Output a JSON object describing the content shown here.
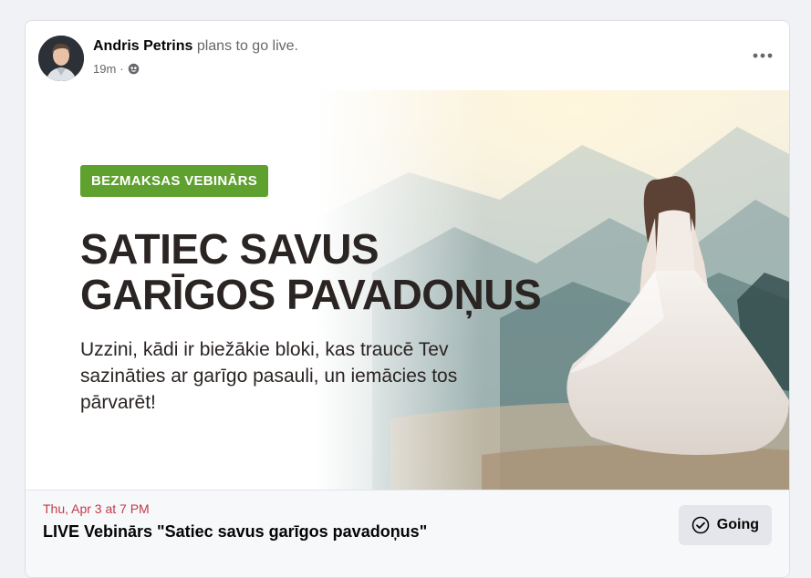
{
  "post": {
    "author": "Andris Petrins",
    "action": "plans to go live.",
    "time": "19m",
    "separator": "·",
    "privacy_icon": "globe-icon",
    "more_icon": "more-horizontal-icon"
  },
  "banner": {
    "badge": "BEZMAKSAS VEBINĀRS",
    "headline_line1": "SATIEC SAVUS",
    "headline_line2": "GARĪGOS PAVADOŅUS",
    "subtext": "Uzzini, kādi ir biežākie bloki, kas traucē Tev sazināties ar garīgo pasauli, un iemācies tos pārvarēt!"
  },
  "event": {
    "date": "Thu, Apr 3 at 7 PM",
    "title": "LIVE Vebinārs \"Satiec savus garīgos pavadoņus\"",
    "going_label": "Going",
    "going_icon": "check-circle-icon"
  },
  "colors": {
    "badge_green": "#5fa12f",
    "date_red": "#c33a48",
    "headline_dark": "#2a2422"
  }
}
